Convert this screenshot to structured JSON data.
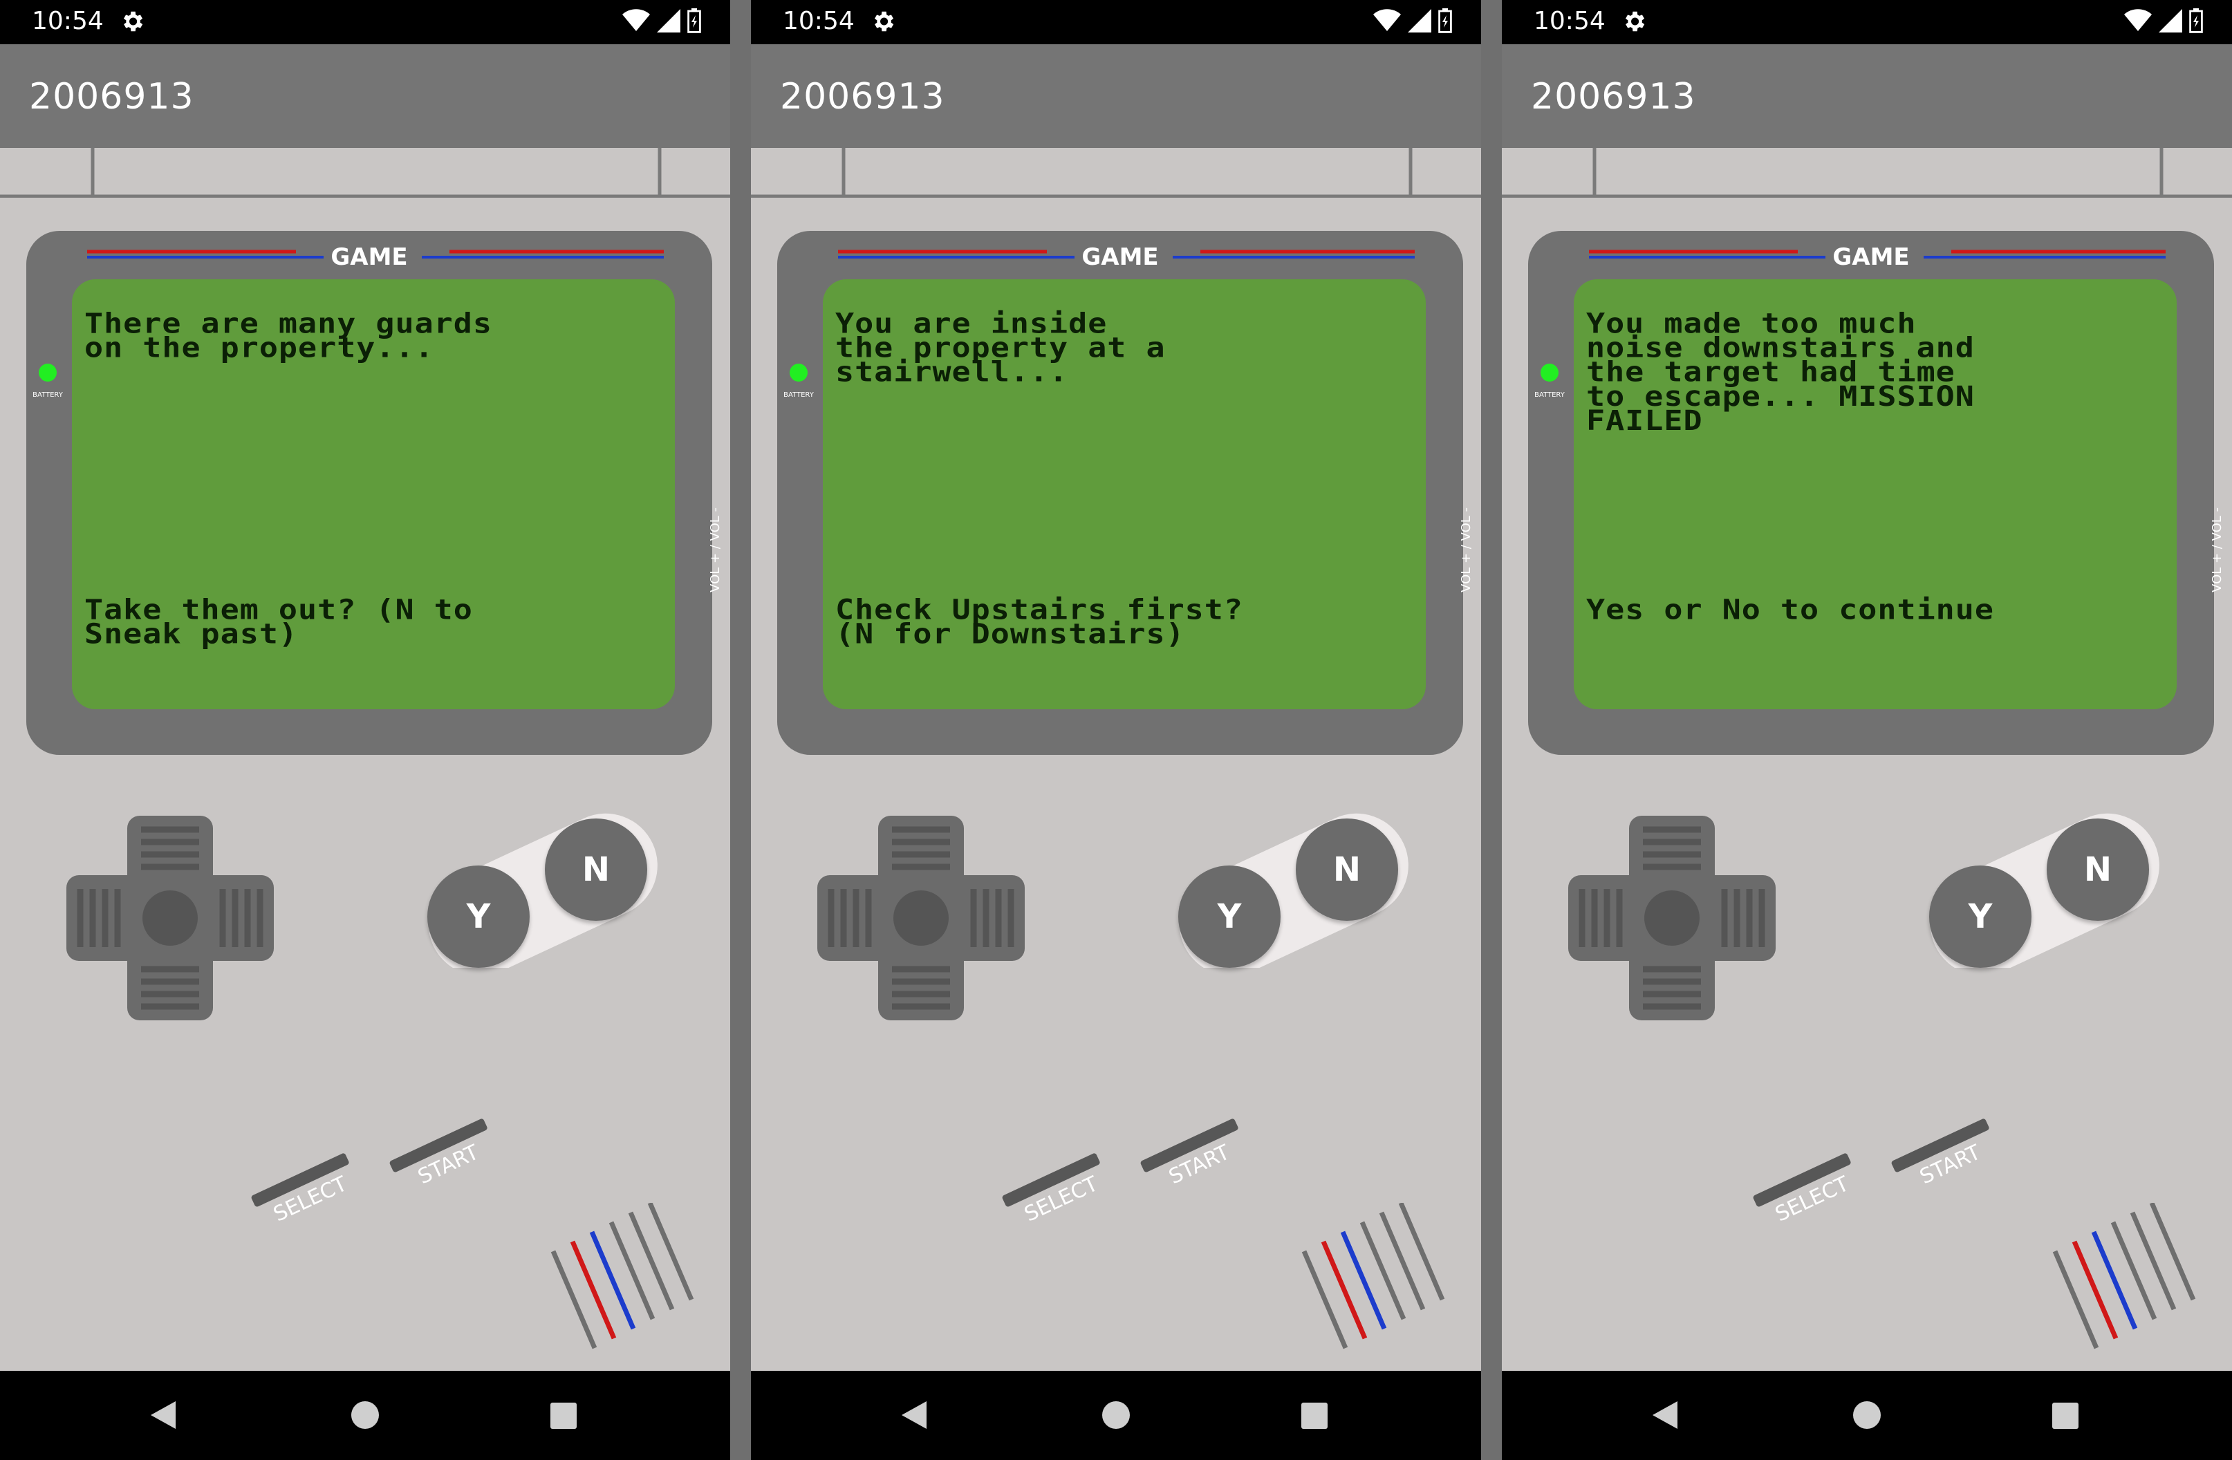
{
  "screens": [
    {
      "status_time": "10:54",
      "app_title": "2006913",
      "console_label": "GAME",
      "battery_label": "BATTERY",
      "volume_label": "VOL + / VOL -",
      "message": "There are many guards\non the property...",
      "prompt": "Take them out? (N to\nSneak past)",
      "buttons": {
        "y": "Y",
        "n": "N",
        "select": "SELECT",
        "start": "START"
      }
    },
    {
      "status_time": "10:54",
      "app_title": "2006913",
      "console_label": "GAME",
      "battery_label": "BATTERY",
      "volume_label": "VOL + / VOL -",
      "message": "You are inside\nthe property at a\nstairwell...",
      "prompt": "Check Upstairs first?\n(N for Downstairs)",
      "buttons": {
        "y": "Y",
        "n": "N",
        "select": "SELECT",
        "start": "START"
      }
    },
    {
      "status_time": "10:54",
      "app_title": "2006913",
      "console_label": "GAME",
      "battery_label": "BATTERY",
      "volume_label": "VOL + / VOL -",
      "message": "You made too much\nnoise downstairs and\nthe target had time\nto escape... MISSION\nFAILED",
      "prompt": "Yes or No to continue",
      "buttons": {
        "y": "Y",
        "n": "N",
        "select": "SELECT",
        "start": "START"
      }
    }
  ],
  "colors": {
    "shell": "#c9c6c5",
    "appbar": "#757575",
    "bezel": "#717171",
    "screen": "#609c3c",
    "screen_text": "#0b1f06",
    "button": "#6b6b6b",
    "battery_led": "#22ee22",
    "accent_red": "#d01818",
    "accent_blue": "#1c3ccc"
  },
  "icons": [
    "settings-gear-icon",
    "wifi-icon",
    "cell-signal-icon",
    "battery-charging-icon",
    "nav-back-icon",
    "nav-home-icon",
    "nav-recents-icon"
  ]
}
